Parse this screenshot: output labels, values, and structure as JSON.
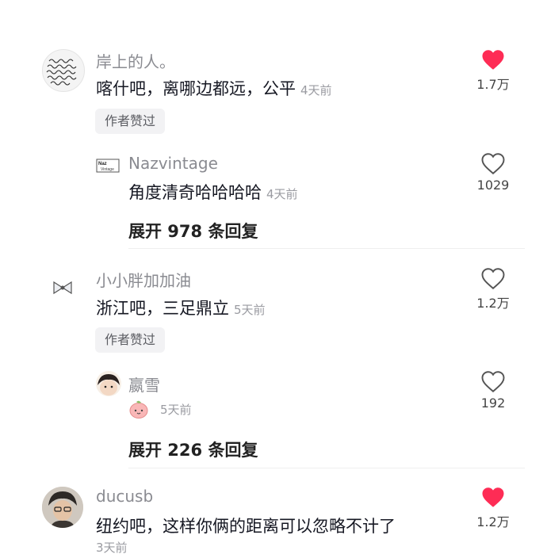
{
  "colors": {
    "liked": "#fe2c55",
    "name": "#8a8b91",
    "text": "#161823",
    "meta": "#9a9ba1"
  },
  "comments": [
    {
      "name": "岸上的人。",
      "text": "喀什吧，离哪边都远，公平",
      "time": "4天前",
      "likes": "1.7万",
      "liked": true,
      "tag": "作者赞过",
      "avatar_icon": "handwriting-avatar",
      "reply": {
        "name": "Nazvintage",
        "text": "角度清奇哈哈哈哈",
        "time": "4天前",
        "likes": "1029",
        "liked": false,
        "avatar_logo": "Naz Vintage"
      },
      "expand_label": "展开 978 条回复"
    },
    {
      "name": "小小胖加加油",
      "text": "浙江吧，三足鼎立",
      "time": "5天前",
      "likes": "1.2万",
      "liked": false,
      "tag": "作者赞过",
      "avatar_icon": "bow-avatar",
      "reply": {
        "name": "嬴雪",
        "text": "",
        "time": "5天前",
        "likes": "192",
        "liked": false,
        "sticker_icon": "peach-emoji-icon"
      },
      "expand_label": "展开 226 条回复"
    },
    {
      "name": "ducusb",
      "text": "纽约吧，这样你俩的距离可以忽略不计了",
      "time": "3天前",
      "likes": "1.2万",
      "liked": true,
      "avatar_icon": "person-avatar"
    }
  ]
}
